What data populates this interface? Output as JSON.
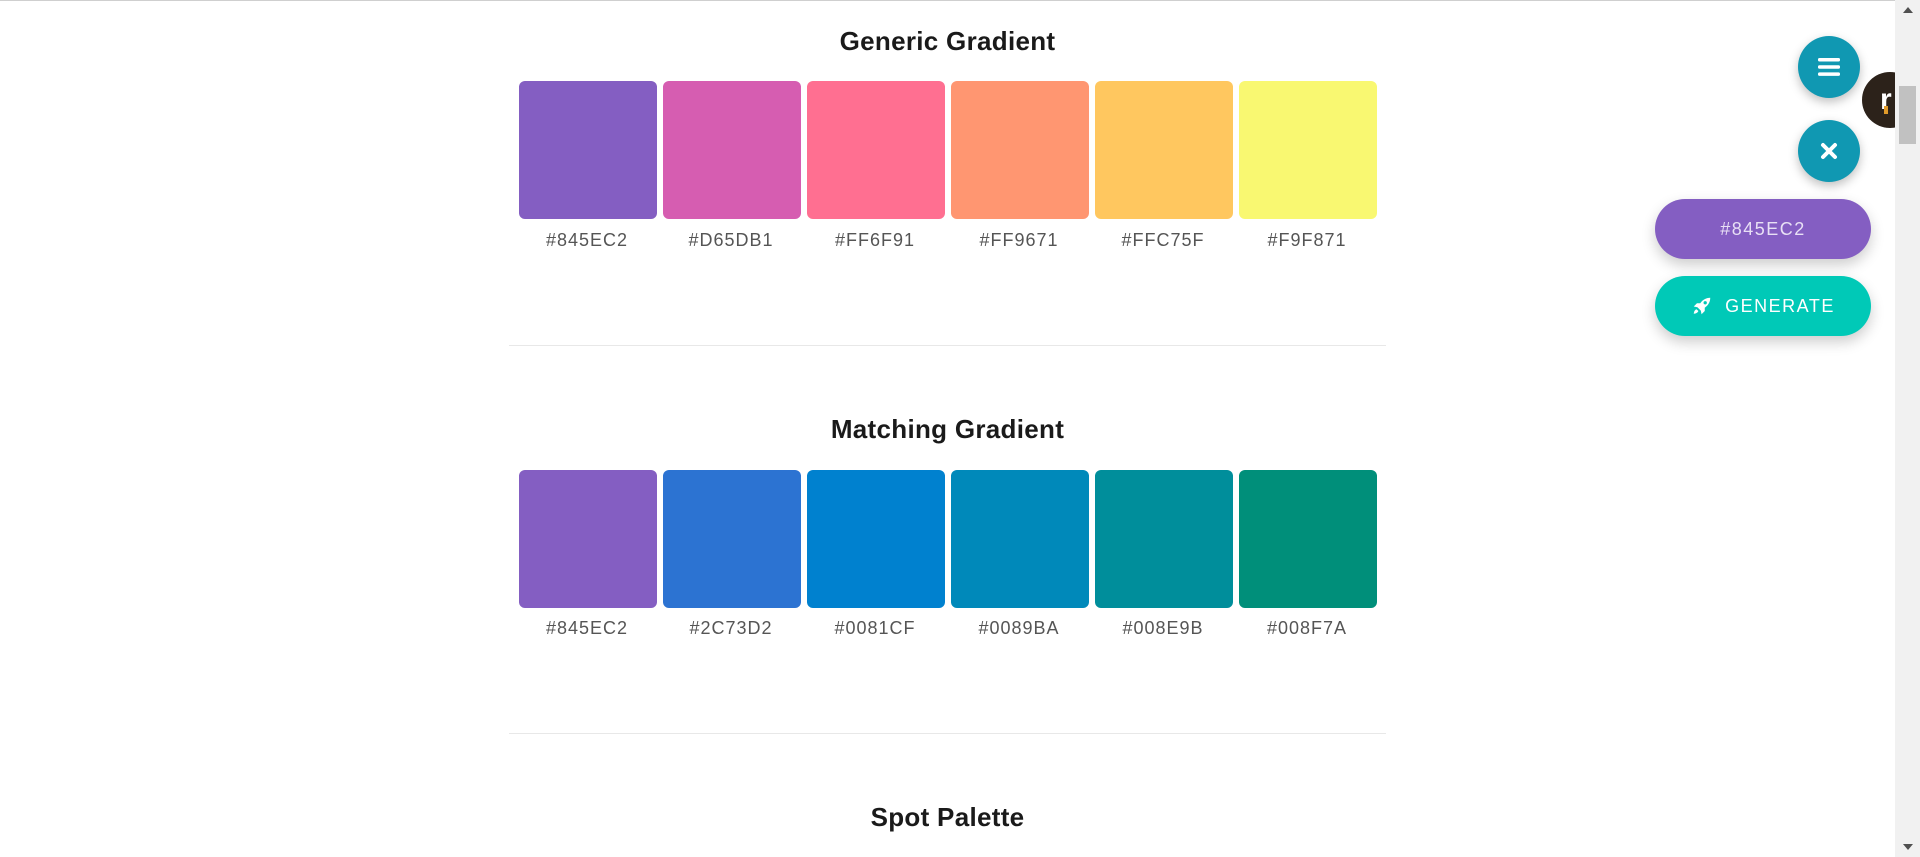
{
  "sections": [
    {
      "title": "Generic Gradient",
      "swatches": [
        {
          "hex": "#845EC2",
          "color": "#845ec2"
        },
        {
          "hex": "#D65DB1",
          "color": "#d65db1"
        },
        {
          "hex": "#FF6F91",
          "color": "#ff6f91"
        },
        {
          "hex": "#FF9671",
          "color": "#ff9671"
        },
        {
          "hex": "#FFC75F",
          "color": "#ffc75f"
        },
        {
          "hex": "#F9F871",
          "color": "#f9f871"
        }
      ]
    },
    {
      "title": "Matching Gradient",
      "swatches": [
        {
          "hex": "#845EC2",
          "color": "#845ec2"
        },
        {
          "hex": "#2C73D2",
          "color": "#2c73d2"
        },
        {
          "hex": "#0081CF",
          "color": "#0081cf"
        },
        {
          "hex": "#0089BA",
          "color": "#0089ba"
        },
        {
          "hex": "#008E9B",
          "color": "#008e9b"
        },
        {
          "hex": "#008F7A",
          "color": "#008f7a"
        }
      ]
    },
    {
      "title": "Spot Palette",
      "swatches": []
    }
  ],
  "controls": {
    "menu_icon": "hamburger-menu-icon",
    "close_icon": "close-icon",
    "selected_color_label": "#845EC2",
    "selected_color": "#845ec2",
    "generate_label": "GENERATE",
    "generate_icon": "rocket-icon",
    "avatar_letter": "r"
  },
  "colors": {
    "fab": "#1098b2",
    "generate": "#00c9b7"
  }
}
